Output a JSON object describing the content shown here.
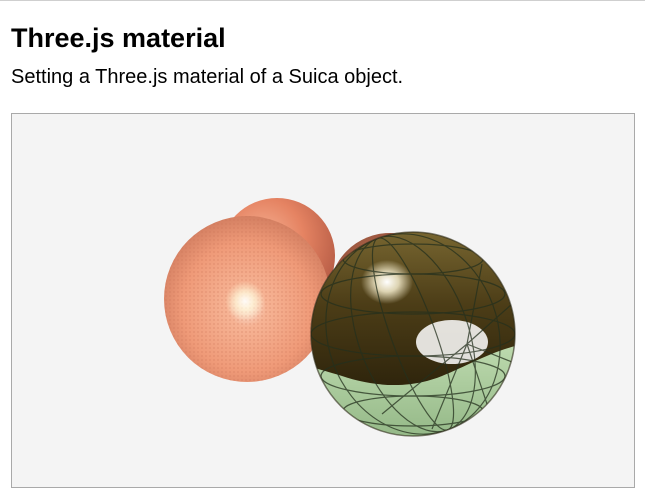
{
  "page": {
    "title": "Three.js material",
    "subtitle": "Setting a Three.js material of a Suica object."
  },
  "scene": {
    "background_color": "#f4f4f4",
    "objects": [
      {
        "name": "back-orange-sphere",
        "color": "#e98163"
      },
      {
        "name": "front-orange-sphere",
        "color": "#f2a27e",
        "surface": "dotted texture"
      },
      {
        "name": "back-brown-sphere",
        "color": "#8a4a35"
      },
      {
        "name": "front-metallic-sphere",
        "colors": [
          "#5c4a1c",
          "#c3dfb6"
        ],
        "surface": "latitude/longitude wireframe"
      }
    ]
  }
}
